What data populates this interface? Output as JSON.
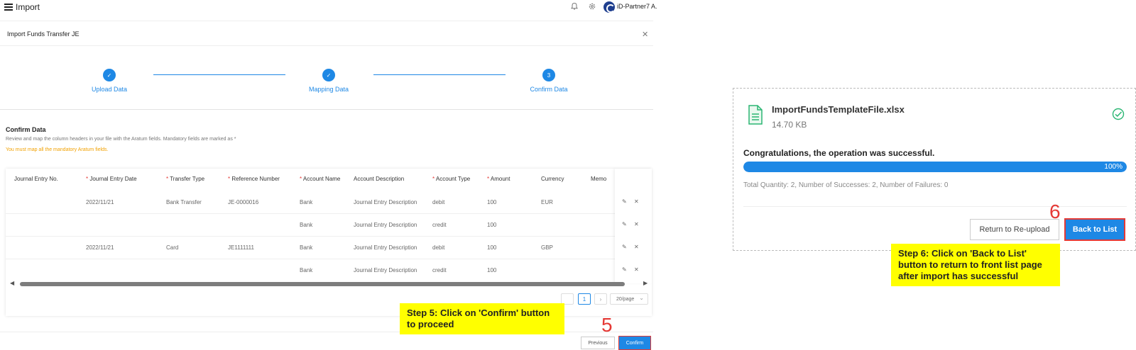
{
  "header": {
    "title": "Import",
    "user_name": "iD-Partner7 A."
  },
  "dialog": {
    "title": "Import Funds Transfer JE"
  },
  "steps": [
    {
      "label": "Upload Data",
      "marker": "✓"
    },
    {
      "label": "Mapping Data",
      "marker": "✓"
    },
    {
      "label": "Confirm Data",
      "marker": "3"
    }
  ],
  "confirm": {
    "title": "Confirm Data",
    "description": "Review and map the column headers in your file with the Aratum fields. Mandatory fields are marked as *",
    "warning": "You must map all the mandatory Aratum fields."
  },
  "table": {
    "columns": [
      {
        "label": "Journal Entry No.",
        "required": false
      },
      {
        "label": "Journal Entry Date",
        "required": true
      },
      {
        "label": "Transfer Type",
        "required": true
      },
      {
        "label": "Reference Number",
        "required": true
      },
      {
        "label": "Account Name",
        "required": true
      },
      {
        "label": "Account Description",
        "required": false
      },
      {
        "label": "Account Type",
        "required": true
      },
      {
        "label": "Amount",
        "required": true
      },
      {
        "label": "Currency",
        "required": false
      },
      {
        "label": "Memo",
        "required": false
      }
    ],
    "rows": [
      [
        "",
        "2022/11/21",
        "Bank Transfer",
        "JE-0000016",
        "Bank",
        "Journal Entry Description",
        "debit",
        "100",
        "EUR",
        ""
      ],
      [
        "",
        "",
        "",
        "",
        "Bank",
        "Journal Entry Description",
        "credit",
        "100",
        "",
        ""
      ],
      [
        "",
        "2022/11/21",
        "Card",
        "JE1111111",
        "Bank",
        "Journal Entry Description",
        "debit",
        "100",
        "GBP",
        ""
      ],
      [
        "",
        "",
        "",
        "",
        "Bank",
        "Journal Entry Description",
        "credit",
        "100",
        "",
        ""
      ]
    ]
  },
  "pagination": {
    "current_page": "1",
    "page_size": "20/page"
  },
  "footer": {
    "previous_label": "Previous",
    "confirm_label": "Confirm"
  },
  "annotations": {
    "step5_note": "Step 5: Click on 'Confirm' button to proceed",
    "step5_number": "5",
    "step6_note": "Step 6: Click on 'Back to List' button to return to front list page after import has successful",
    "step6_number": "6"
  },
  "result": {
    "file_name": "ImportFundsTemplateFile.xlsx",
    "file_size": "14.70 KB",
    "success_message": "Congratulations, the operation was successful.",
    "progress": 100,
    "progress_label": "100%",
    "summary": "Total Quantity: 2, Number of Successes: 2, Number of Failures: 0",
    "reupload_label": "Return to Re-upload",
    "back_label": "Back to List"
  },
  "colors": {
    "primary": "#1e88e5",
    "required_mark": "#e53935",
    "warning": "#f2a100",
    "success_icon": "#2bb673",
    "highlight_note": "#ffff00",
    "annotation_red": "#e53935"
  },
  "icons": [
    "menu-icon",
    "bell-icon",
    "gear-icon",
    "close-icon",
    "check-icon",
    "edit-icon",
    "delete-icon",
    "file-icon",
    "check-circle-icon",
    "chevron-left-icon",
    "chevron-right-icon",
    "chevron-down-icon"
  ]
}
